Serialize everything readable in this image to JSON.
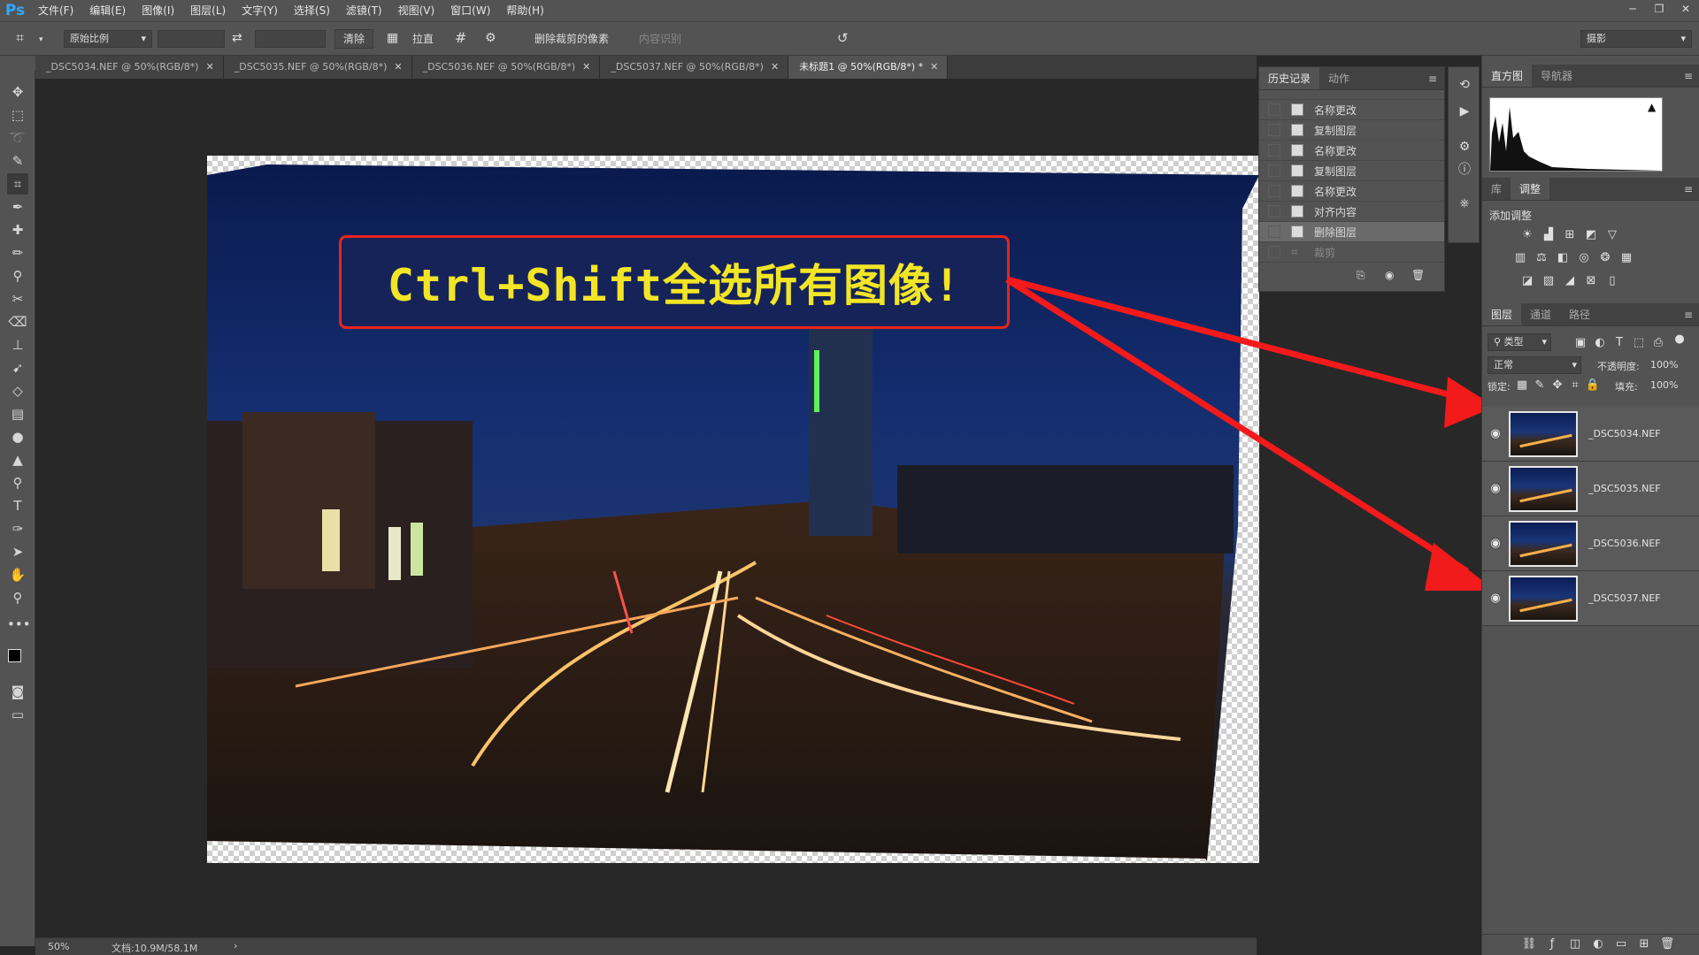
{
  "menubar": {
    "logo": "Ps",
    "items": [
      "文件(F)",
      "编辑(E)",
      "图像(I)",
      "图层(L)",
      "文字(Y)",
      "选择(S)",
      "滤镜(T)",
      "视图(V)",
      "窗口(W)",
      "帮助(H)"
    ],
    "window_controls": [
      "─",
      "❐",
      "✕"
    ]
  },
  "options": {
    "ratio": "原始比例",
    "clear": "清除",
    "straighten": "拉直",
    "delete_cropped": "删除裁剪的像素",
    "content_aware": "内容识别",
    "workspace": "摄影"
  },
  "tabs": [
    {
      "label": "_DSC5034.NEF @ 50%(RGB/8*)",
      "active": false
    },
    {
      "label": "_DSC5035.NEF @ 50%(RGB/8*)",
      "active": false
    },
    {
      "label": "_DSC5036.NEF @ 50%(RGB/8*)",
      "active": false
    },
    {
      "label": "_DSC5037.NEF @ 50%(RGB/8*)",
      "active": false
    },
    {
      "label": "未标题1 @ 50%(RGB/8*) *",
      "active": true
    }
  ],
  "callout": {
    "text": "Ctrl+Shift全选所有图像!"
  },
  "status": {
    "zoom": "50%",
    "doc": "文档:10.9M/58.1M"
  },
  "history": {
    "tabs": [
      "历史记录",
      "动作"
    ],
    "rows": [
      {
        "label": "名称更改"
      },
      {
        "label": "复制图层"
      },
      {
        "label": "名称更改"
      },
      {
        "label": "复制图层"
      },
      {
        "label": "名称更改"
      },
      {
        "label": "对齐内容"
      },
      {
        "label": "删除图层",
        "selected": true
      },
      {
        "label": "裁剪",
        "dim": true
      }
    ]
  },
  "right": {
    "top_tabs": [
      "直方图",
      "导航器"
    ],
    "adj_tabs": [
      "库",
      "调整"
    ],
    "add_adjust": "添加调整",
    "layer_tabs": [
      "图层",
      "通道",
      "路径"
    ],
    "kind": "类型",
    "blend": "正常",
    "opacity_label": "不透明度:",
    "opacity": "100%",
    "lock_label": "锁定:",
    "fill_label": "填充:",
    "fill": "100%",
    "layers": [
      "_DSC5034.NEF",
      "_DSC5035.NEF",
      "_DSC5036.NEF",
      "_DSC5037.NEF"
    ]
  },
  "colors": {
    "ui_bg": "#535353",
    "canvas_bg": "#282828",
    "callout_border": "#e8241c",
    "callout_text": "#f2e526",
    "arrow": "#f21a1a"
  }
}
